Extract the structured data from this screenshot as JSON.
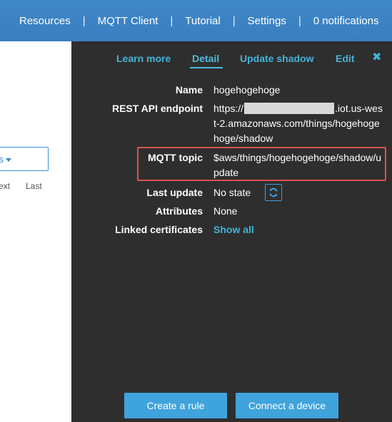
{
  "topnav": {
    "items": [
      "Resources",
      "MQTT Client",
      "Tutorial",
      "Settings",
      "0 notifications"
    ],
    "separator": "|"
  },
  "left": {
    "actions_label": "ns",
    "pager_next": "ext",
    "pager_last": "Last"
  },
  "panel": {
    "tabs": [
      "Learn more",
      "Detail",
      "Update shadow",
      "Edit"
    ],
    "active_tab": "Detail",
    "close_glyph": "✖",
    "fields": {
      "name_label": "Name",
      "name_value": "hogehogehoge",
      "endpoint_label": "REST API endpoint",
      "endpoint_prefix": "https://",
      "endpoint_suffix": ".iot.us-west-2.amazonaws.com/things/hogehogehoge/shadow",
      "mqtt_label": "MQTT topic",
      "mqtt_value": "$aws/things/hogehogehoge/shadow/update",
      "last_update_label": "Last update",
      "last_update_value": "No state",
      "attributes_label": "Attributes",
      "attributes_value": "None",
      "certs_label": "Linked certificates",
      "certs_link": "Show all"
    },
    "buttons": {
      "create_rule": "Create a rule",
      "connect_device": "Connect a device"
    }
  },
  "colors": {
    "topbar": "#3d85c6",
    "panel": "#2e2e2e",
    "accent": "#45b3d8",
    "button": "#3fa3dc",
    "highlight_border": "#d9534f"
  },
  "icons": [
    "refresh-icon",
    "close-icon",
    "caret-down-icon"
  ]
}
